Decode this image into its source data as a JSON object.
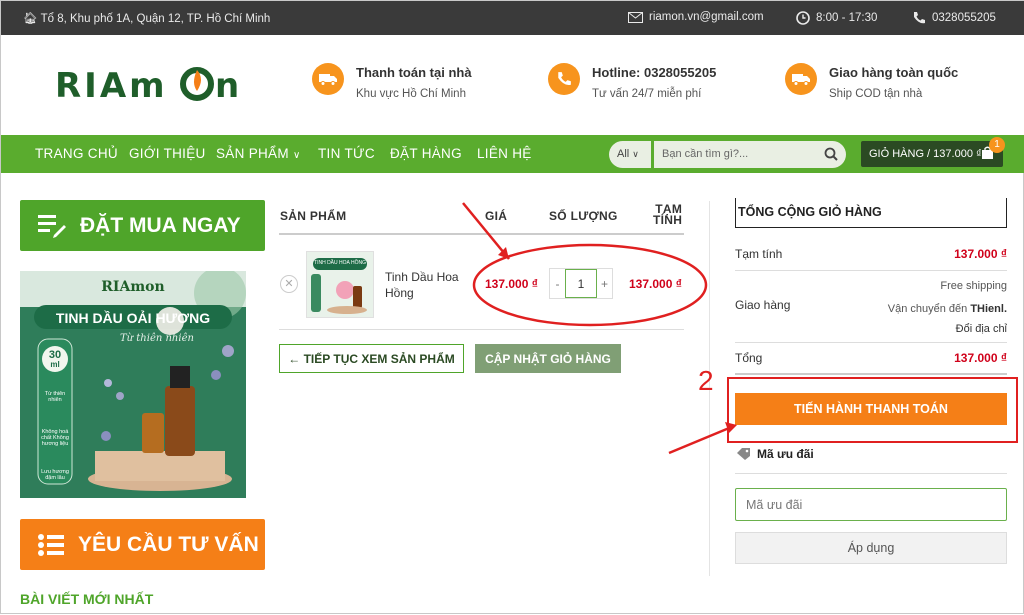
{
  "topbar": {
    "address": "Tổ 8, Khu phố 1A, Quận 12, TP. Hồ Chí Minh",
    "email": "riamon.vn@gmail.com",
    "hours": "8:00 - 17:30",
    "phone": "0328055205"
  },
  "header": {
    "logo": "RIAmon",
    "info": [
      {
        "title": "Thanh toán tại nhà",
        "sub": "Khu vực Hồ Chí Minh",
        "icon": "delivery-truck-icon"
      },
      {
        "title": "Hotline: 0328055205",
        "sub": "Tư vấn 24/7 miễn phí",
        "icon": "phone-icon"
      },
      {
        "title": "Giao hàng toàn quốc",
        "sub": "Ship COD tận nhà",
        "icon": "delivery-truck-icon"
      }
    ]
  },
  "nav": {
    "items": [
      "TRANG CHỦ",
      "GIỚI THIỆU",
      "SẢN PHẨM",
      "TIN TỨC",
      "ĐẶT HÀNG",
      "LIÊN HỆ"
    ],
    "search_select": "All",
    "search_placeholder": "Bạn cần tìm gì?...",
    "cart_label": "GIỎ HÀNG / 137.000 ₫",
    "cart_count": "1"
  },
  "sidebar": {
    "order_now": "ĐẶT MUA NGAY",
    "promo_brand": "RIAmon",
    "promo_title": "TINH DẦU OẢI HƯƠNG",
    "promo_script": "Từ thiên nhiên",
    "promo_badge_num": "30",
    "promo_badge_unit": "ml",
    "promo_features": [
      "Từ thiên nhiên",
      "Không hoá chất Không hương liệu",
      "Lưu hương đậm lâu"
    ],
    "consult": "YÊU CẦU TƯ VẤN",
    "latest_posts": "BÀI VIẾT MỚI NHẤT"
  },
  "cart": {
    "headers": {
      "product": "SẢN PHẨM",
      "price": "GIÁ",
      "qty": "SỐ LƯỢNG",
      "subtotal_1": "TẠM",
      "subtotal_2": "TÍNH"
    },
    "item": {
      "name_line1": "Tinh Dầu Hoa",
      "name_line2": "Hồng",
      "img_label": "TINH DẦU HOA HỒNG",
      "price": "137.000 ₫",
      "qty": "1",
      "subtotal": "137.000 ₫"
    },
    "continue": "← TIẾP TỤC XEM SẢN PHẨM",
    "update": "CẬP NHẬT GIỎ HÀNG"
  },
  "summary": {
    "title": "TỔNG CỘNG GIỎ HÀNG",
    "subtotal_label": "Tạm tính",
    "subtotal_value": "137.000 ₫",
    "ship_label": "Giao hàng",
    "ship_free": "Free shipping",
    "ship_to_prefix": "Vận chuyển đến",
    "ship_to_place": "THienl.",
    "ship_change": "Đổi địa chỉ",
    "total_label": "Tổng",
    "total_value": "137.000 ₫",
    "checkout": "TIẾN HÀNH THANH TOÁN",
    "coupon_label": "Mã ưu đãi",
    "coupon_placeholder": "Mã ưu đãi",
    "apply": "Áp dụng"
  },
  "annotations": {
    "step_number": "2",
    "highlight_color": "#e02020"
  },
  "colors": {
    "green": "#5aac2e",
    "orange": "#f57f17",
    "price_red": "#d0021b",
    "dark_bar": "#3a3a3a"
  }
}
